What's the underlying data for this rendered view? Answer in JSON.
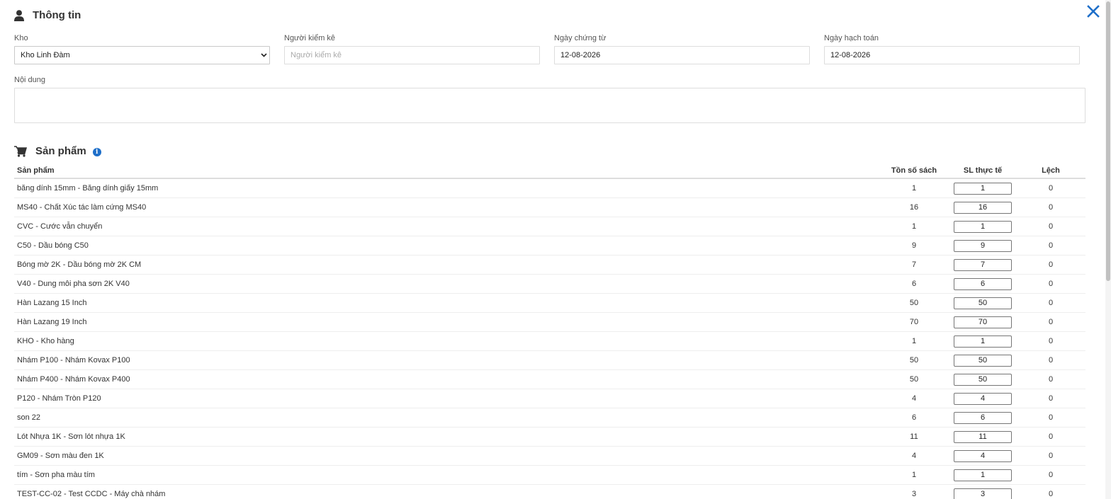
{
  "info": {
    "title": "Thông tin"
  },
  "form": {
    "kho_label": "Kho",
    "kho_value": "Kho Linh Đàm",
    "nguoi_label": "Người kiểm kê",
    "nguoi_placeholder": "Người kiểm kê",
    "ngay_ct_label": "Ngày chứng từ",
    "ngay_ct_value": "12-08-2026",
    "ngay_ht_label": "Ngày hạch toán",
    "ngay_ht_value": "12-08-2026",
    "noidung_label": "Nội dung",
    "noidung_value": ""
  },
  "products": {
    "title": "Sản phẩm",
    "info_icon_text": "i",
    "columns": {
      "product": "Sản phẩm",
      "ton": "Tồn số sách",
      "sl": "SL thực tế",
      "lech": "Lệch"
    },
    "rows": [
      {
        "name": "băng dính 15mm - Băng dính giấy 15mm",
        "ton": "1",
        "sl": "1",
        "lech": "0"
      },
      {
        "name": "MS40 - Chất Xúc tác làm cứng MS40",
        "ton": "16",
        "sl": "16",
        "lech": "0"
      },
      {
        "name": "CVC - Cước vẫn chuyển",
        "ton": "1",
        "sl": "1",
        "lech": "0"
      },
      {
        "name": "C50 - Dầu bóng C50",
        "ton": "9",
        "sl": "9",
        "lech": "0"
      },
      {
        "name": "Bóng mờ 2K - Dầu bóng mờ 2K CM",
        "ton": "7",
        "sl": "7",
        "lech": "0"
      },
      {
        "name": "V40 - Dung môi pha sơn 2K V40",
        "ton": "6",
        "sl": "6",
        "lech": "0"
      },
      {
        "name": "Hàn Lazang 15 Inch",
        "ton": "50",
        "sl": "50",
        "lech": "0"
      },
      {
        "name": "Hàn Lazang 19 Inch",
        "ton": "70",
        "sl": "70",
        "lech": "0"
      },
      {
        "name": "KHO - Kho hàng",
        "ton": "1",
        "sl": "1",
        "lech": "0"
      },
      {
        "name": "Nhám P100 - Nhám Kovax P100",
        "ton": "50",
        "sl": "50",
        "lech": "0"
      },
      {
        "name": "Nhám P400 - Nhám Kovax P400",
        "ton": "50",
        "sl": "50",
        "lech": "0"
      },
      {
        "name": "P120 - Nhám Tròn P120",
        "ton": "4",
        "sl": "4",
        "lech": "0"
      },
      {
        "name": "son 22",
        "ton": "6",
        "sl": "6",
        "lech": "0"
      },
      {
        "name": "Lót Nhựa 1K - Sơn lót nhựa 1K",
        "ton": "11",
        "sl": "11",
        "lech": "0"
      },
      {
        "name": "GM09 - Sơn màu đen 1K",
        "ton": "4",
        "sl": "4",
        "lech": "0"
      },
      {
        "name": "tím - Sơn pha màu tím",
        "ton": "1",
        "sl": "1",
        "lech": "0"
      },
      {
        "name": "TEST-CC-02 - Test CCDC - Máy chà nhám",
        "ton": "3",
        "sl": "3",
        "lech": "0"
      }
    ]
  },
  "colors": {
    "accent": "#1e6fc9",
    "text": "#333333",
    "border": "#dddddd"
  },
  "icons": {
    "info_section": "user-icon",
    "products_section": "cart-icon",
    "close": "close-icon",
    "info": "info-icon"
  }
}
